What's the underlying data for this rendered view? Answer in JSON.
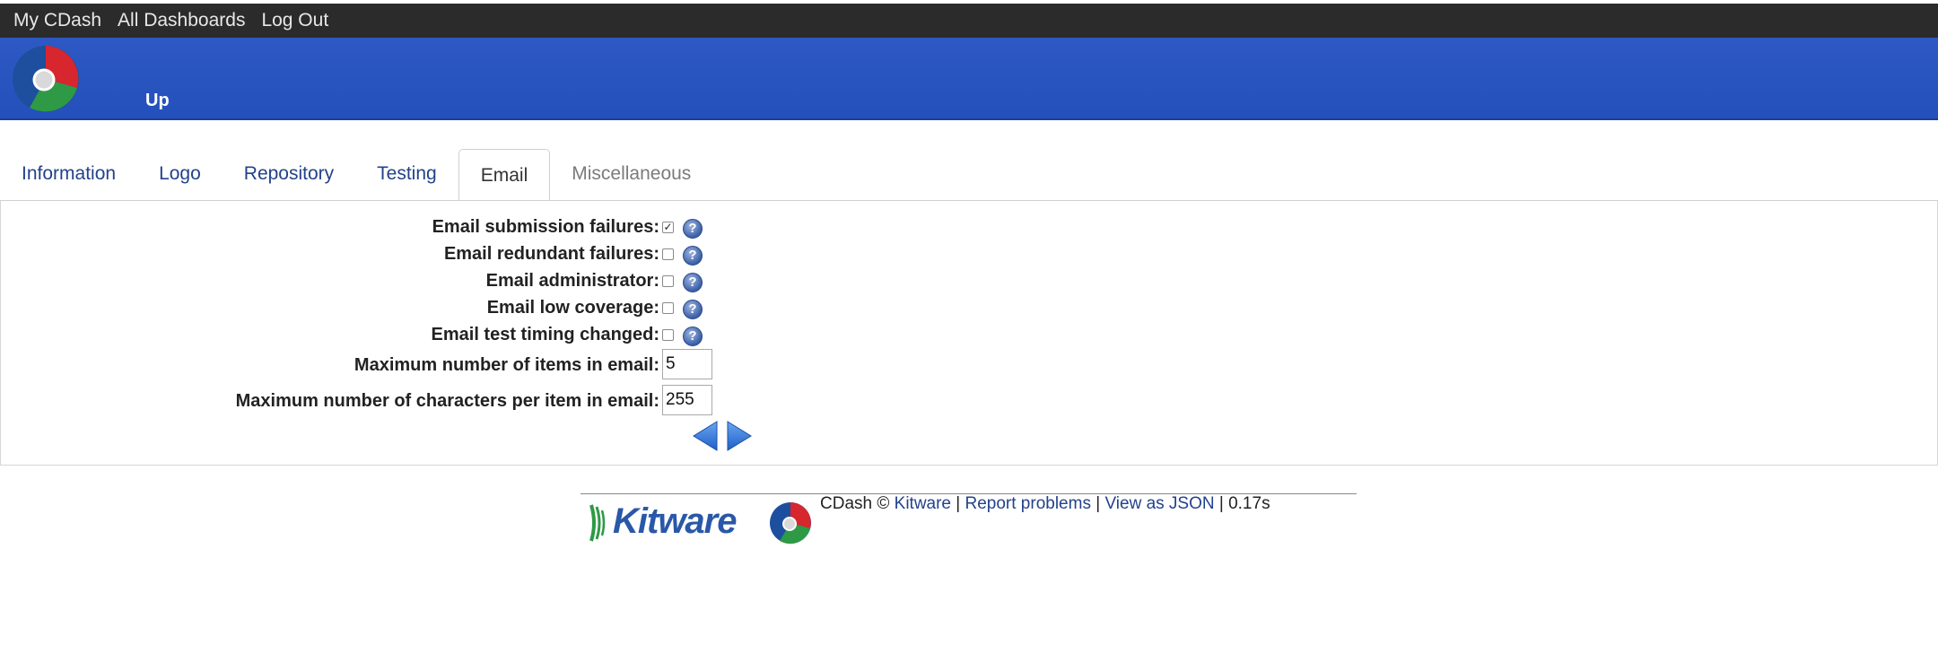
{
  "topnav": {
    "my_cdash": "My CDash",
    "all_dashboards": "All Dashboards",
    "log_out": "Log Out"
  },
  "header": {
    "project_title": "Up"
  },
  "tabs": [
    {
      "label": "Information"
    },
    {
      "label": "Logo"
    },
    {
      "label": "Repository"
    },
    {
      "label": "Testing"
    },
    {
      "label": "Email"
    },
    {
      "label": "Miscellaneous"
    }
  ],
  "active_tab": "Email",
  "email_form": {
    "submission_failures": {
      "label": "Email submission failures:",
      "checked": true
    },
    "redundant_failures": {
      "label": "Email redundant failures:",
      "checked": false
    },
    "administrator": {
      "label": "Email administrator:",
      "checked": false
    },
    "low_coverage": {
      "label": "Email low coverage:",
      "checked": false
    },
    "test_timing_changed": {
      "label": "Email test timing changed:",
      "checked": false
    },
    "max_items": {
      "label": "Maximum number of items in email:",
      "value": "5"
    },
    "max_chars": {
      "label": "Maximum number of characters per item in email:",
      "value": "255"
    },
    "help_glyph": "?",
    "check_glyph": "✓"
  },
  "footer": {
    "kitware_logo_text": "Kitware",
    "cdash_copy": "CDash ©",
    "kitware_link": "Kitware",
    "sep1": "|",
    "report_problems": "Report problems",
    "sep2": "|",
    "view_json": "View as JSON",
    "timing": "| 0.17s"
  },
  "colors": {
    "topbar_bg": "#2b2b2b",
    "header_bg": "#2e59c4",
    "link": "#23428b",
    "muted_tab": "#7b7b7b"
  }
}
